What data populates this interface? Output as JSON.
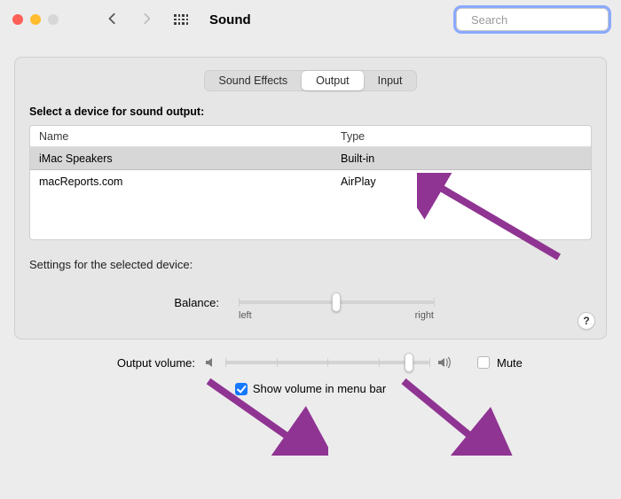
{
  "window": {
    "title": "Sound"
  },
  "search": {
    "placeholder": "Search",
    "value": ""
  },
  "tabs": {
    "items": [
      {
        "label": "Sound Effects",
        "active": false
      },
      {
        "label": "Output",
        "active": true
      },
      {
        "label": "Input",
        "active": false
      }
    ]
  },
  "output": {
    "section_title": "Select a device for sound output:",
    "columns": {
      "name": "Name",
      "type": "Type"
    },
    "devices": [
      {
        "name": "iMac Speakers",
        "type": "Built-in",
        "selected": true
      },
      {
        "name": "macReports.com",
        "type": "AirPlay",
        "selected": false
      }
    ],
    "settings_label": "Settings for the selected device:",
    "balance": {
      "label": "Balance:",
      "left": "left",
      "right": "right",
      "value_percent": 50
    }
  },
  "footer": {
    "output_volume_label": "Output volume:",
    "volume_percent": 90,
    "mute_label": "Mute",
    "mute_checked": false,
    "menubar_label": "Show volume in menu bar",
    "menubar_checked": true
  },
  "help": {
    "label": "?"
  },
  "icons": {
    "search": "magnifying-glass",
    "speaker_low": "speaker-low",
    "speaker_high": "speaker-high"
  },
  "annotations": {
    "arrows": [
      {
        "target": "airplay-row",
        "color": "#8f3492"
      },
      {
        "target": "output-volume-slider",
        "color": "#8f3492"
      },
      {
        "target": "mute-checkbox",
        "color": "#8f3492"
      }
    ]
  }
}
